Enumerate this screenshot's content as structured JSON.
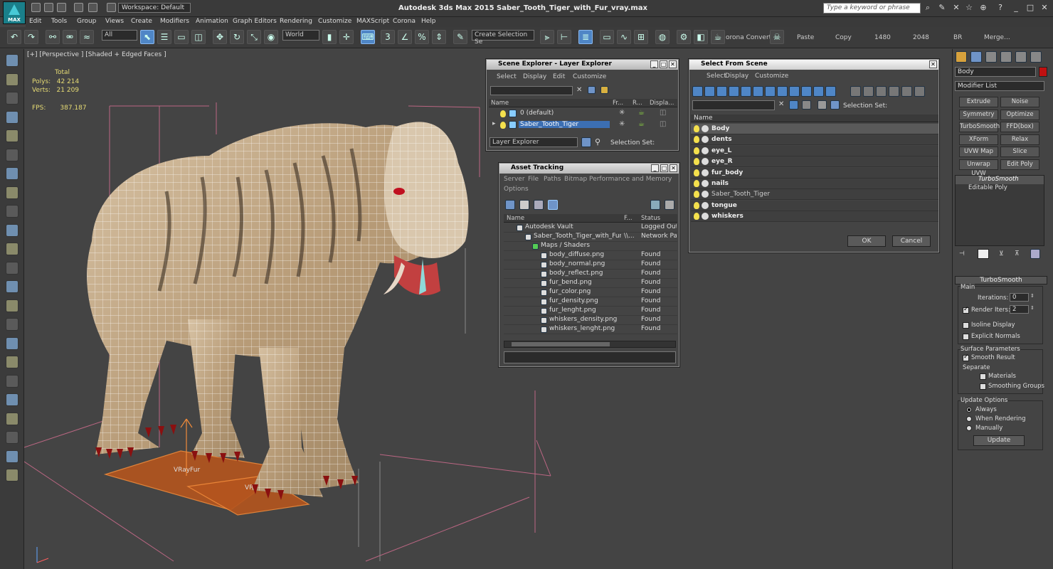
{
  "app": {
    "logo": "MAX",
    "workspace": "Workspace: Default",
    "title": "Autodesk 3ds Max  2015     Saber_Tooth_Tiger_with_Fur_vray.max",
    "search_placeholder": "Type a keyword or phrase"
  },
  "menu": [
    "Edit",
    "Tools",
    "Group",
    "Views",
    "Create",
    "Modifiers",
    "Animation",
    "Graph Editors",
    "Rendering",
    "Customize",
    "MAXScript",
    "Corona",
    "Help"
  ],
  "toolbar": {
    "filter": "All",
    "refcoord": "World",
    "selset_placeholder": "Create Selection Se",
    "corona_convert": "orona Convert",
    "paste": "Paste",
    "copy": "Copy",
    "w": "1480",
    "h": "2048",
    "br": "BR",
    "merge": "Merge..."
  },
  "viewport": {
    "label": "[+] [Perspective ] [Shaded + Edged Faces ]",
    "stats_total": "Total",
    "polys_label": "Polys:",
    "polys_value": "42 214",
    "verts_label": "Verts:",
    "verts_value": "21 209",
    "fps_label": "FPS:",
    "fps_value": "387.187",
    "vrayfur1": "VRayFur",
    "vrayfur2": "VRayFur"
  },
  "scene_explorer": {
    "title": "Scene Explorer - Layer Explorer",
    "menus": [
      "Select",
      "Display",
      "Edit",
      "Customize"
    ],
    "cols": [
      "Name",
      "Fr...",
      "R...",
      "Displa..."
    ],
    "rows": [
      "0 (default)",
      "Saber_Tooth_Tiger"
    ],
    "footer": "Layer Explorer",
    "selset": "Selection Set:"
  },
  "asset_tracking": {
    "title": "Asset Tracking",
    "menus": [
      "Server",
      "File",
      "Paths",
      "Bitmap Performance and Memory"
    ],
    "menu2": "Options",
    "cols": [
      "Name",
      "F...",
      "Status"
    ],
    "rows": [
      [
        "Autodesk Vault",
        "",
        "Logged Out ("
      ],
      [
        "Saber_Tooth_Tiger_with_Fur...",
        "\\\\...",
        "Network Path"
      ],
      [
        "Maps / Shaders",
        "",
        ""
      ],
      [
        "body_diffuse.png",
        "",
        "Found"
      ],
      [
        "body_normal.png",
        "",
        "Found"
      ],
      [
        "body_reflect.png",
        "",
        "Found"
      ],
      [
        "fur_bend.png",
        "",
        "Found"
      ],
      [
        "fur_color.png",
        "",
        "Found"
      ],
      [
        "fur_density.png",
        "",
        "Found"
      ],
      [
        "fur_lenght.png",
        "",
        "Found"
      ],
      [
        "whiskers_density.png",
        "",
        "Found"
      ],
      [
        "whiskers_lenght.png",
        "",
        "Found"
      ]
    ]
  },
  "select_scene": {
    "title": "Select From Scene",
    "menus": [
      "Select",
      "Display",
      "Customize"
    ],
    "selset": "Selection Set:",
    "col": "Name",
    "rows": [
      "Body",
      "dents",
      "eye_L",
      "eye_R",
      "fur_body",
      "nails",
      "Saber_Tooth_Tiger",
      "tongue",
      "whiskers"
    ],
    "ok": "OK",
    "cancel": "Cancel"
  },
  "cmd": {
    "object_name": "Body",
    "modifier_list": "Modifier List",
    "buttons": [
      "Extrude",
      "Noise",
      "Symmetry",
      "Optimize",
      "TurboSmooth",
      "FFD(box)",
      "XForm",
      "Relax",
      "UVW Map",
      "Slice",
      "Unwrap UVW",
      "Edit Poly"
    ],
    "stack": [
      "TurboSmooth",
      "Editable Poly"
    ],
    "rollout": "TurboSmooth",
    "main": "Main",
    "iterations_label": "Iterations:",
    "iterations": "0",
    "render_iters_label": "Render Iters:",
    "render_iters": "2",
    "isoline": "Isoline Display",
    "explicit": "Explicit Normals",
    "surface": "Surface Parameters",
    "smooth": "Smooth Result",
    "separate": "Separate",
    "materials": "Materials",
    "smoothing": "Smoothing Groups",
    "update_options": "Update Options",
    "always": "Always",
    "when_rendering": "When Rendering",
    "manually": "Manually",
    "update": "Update"
  }
}
